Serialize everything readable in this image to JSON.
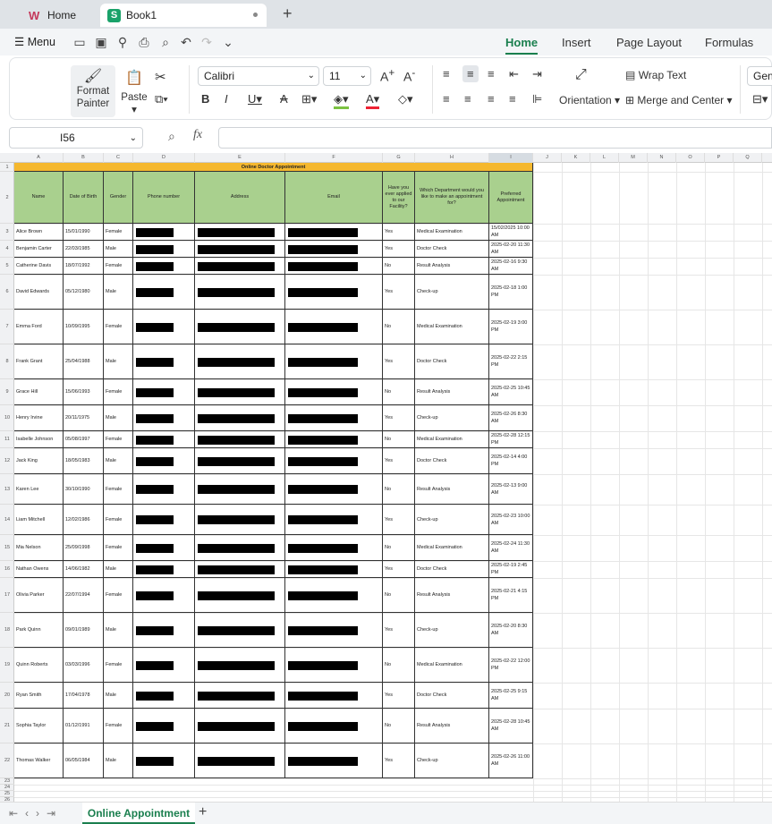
{
  "tabs": {
    "home": "Home",
    "book": "Book1"
  },
  "menu": {
    "menu_label": "Menu",
    "ribbon_tabs": [
      "Home",
      "Insert",
      "Page Layout",
      "Formulas"
    ]
  },
  "ribbon": {
    "format_painter": "Format Painter",
    "paste": "Paste",
    "font": "Calibri",
    "font_size": "11",
    "wrap_text": "Wrap Text",
    "orientation": "Orientation",
    "merge_center": "Merge and Center",
    "number_format": "Gen"
  },
  "formula_bar": {
    "cell_ref": "I56",
    "fx": "fx",
    "value": ""
  },
  "sheet": {
    "columns": [
      "A",
      "B",
      "C",
      "D",
      "E",
      "F",
      "G",
      "H",
      "I",
      "J",
      "K",
      "L",
      "M",
      "N",
      "O",
      "P",
      "Q"
    ],
    "title": "Online Doctor Appointment",
    "headers": [
      "Name",
      "Date of Birth",
      "Gender",
      "Phone number",
      "Address",
      "Email",
      "Have you ever applied to our Facility?",
      "Which Department would you like to make an appointment for?",
      "Preferred Appointment"
    ],
    "rows": [
      [
        "Alice Brown",
        "15/01/1990",
        "Female",
        "Yes",
        "Medical Examination",
        "15/02/2025 10:00 AM"
      ],
      [
        "Benjamin Carter",
        "22/03/1985",
        "Male",
        "Yes",
        "Doctor Check",
        "2025-02-20 11:30 AM"
      ],
      [
        "Catherine Davis",
        "18/07/1992",
        "Female",
        "No",
        "Result Analysis",
        "2025-02-16 9:30 AM"
      ],
      [
        "David Edwards",
        "05/12/1980",
        "Male",
        "Yes",
        "Check-up",
        "2025-02-18 1:00 PM"
      ],
      [
        "Emma Ford",
        "10/09/1995",
        "Female",
        "No",
        "Medical Examination",
        "2025-02-19 3:00 PM"
      ],
      [
        "Frank Grant",
        "25/04/1988",
        "Male",
        "Yes",
        "Doctor Check",
        "2025-02-22 2:15 PM"
      ],
      [
        "Grace Hill",
        "15/06/1993",
        "Female",
        "No",
        "Result Analysis",
        "2025-02-25 10:45 AM"
      ],
      [
        "Henry Irvine",
        "20/11/1975",
        "Male",
        "Yes",
        "Check-up",
        "2025-02-26 8:30 AM"
      ],
      [
        "Isabelle Johnson",
        "05/08/1997",
        "Female",
        "No",
        "Medical Examination",
        "2025-02-28 12:15 PM"
      ],
      [
        "Jack King",
        "18/05/1983",
        "Male",
        "Yes",
        "Doctor Check",
        "2025-02-14 4:00 PM"
      ],
      [
        "Karen Lee",
        "30/10/1990",
        "Female",
        "No",
        "Result Analysis",
        "2025-02-13 9:00 AM"
      ],
      [
        "Liam Mitchell",
        "12/02/1986",
        "Female",
        "Yes",
        "Check-up",
        "2025-02-23 10:00 AM"
      ],
      [
        "Mia Nelson",
        "25/09/1998",
        "Female",
        "No",
        "Medical Examination",
        "2025-02-24 11:30 AM"
      ],
      [
        "Nathan Owens",
        "14/06/1982",
        "Male",
        "Yes",
        "Doctor Check",
        "2025-02-19 2:45 PM"
      ],
      [
        "Olivia Parker",
        "22/07/1994",
        "Female",
        "No",
        "Result Analysis",
        "2025-02-21 4:15 PM"
      ],
      [
        "Park Quinn",
        "09/01/1989",
        "Male",
        "Yes",
        "Check-up",
        "2025-02-20 8:30 AM"
      ],
      [
        "Quinn Roberts",
        "03/03/1996",
        "Female",
        "No",
        "Medical Examination",
        "2025-02-22 12:00 PM"
      ],
      [
        "Ryan Smith",
        "17/04/1978",
        "Male",
        "Yes",
        "Doctor Check",
        "2025-02-25 9:15 AM"
      ],
      [
        "Sophia Taylor",
        "01/12/1991",
        "Female",
        "No",
        "Result Analysis",
        "2025-02-28 10:45 AM"
      ],
      [
        "Thomas Walker",
        "06/05/1984",
        "Male",
        "Yes",
        "Check-up",
        "2025-02-26 11:00 AM"
      ]
    ]
  },
  "sheet_tab": "Online Appointment"
}
